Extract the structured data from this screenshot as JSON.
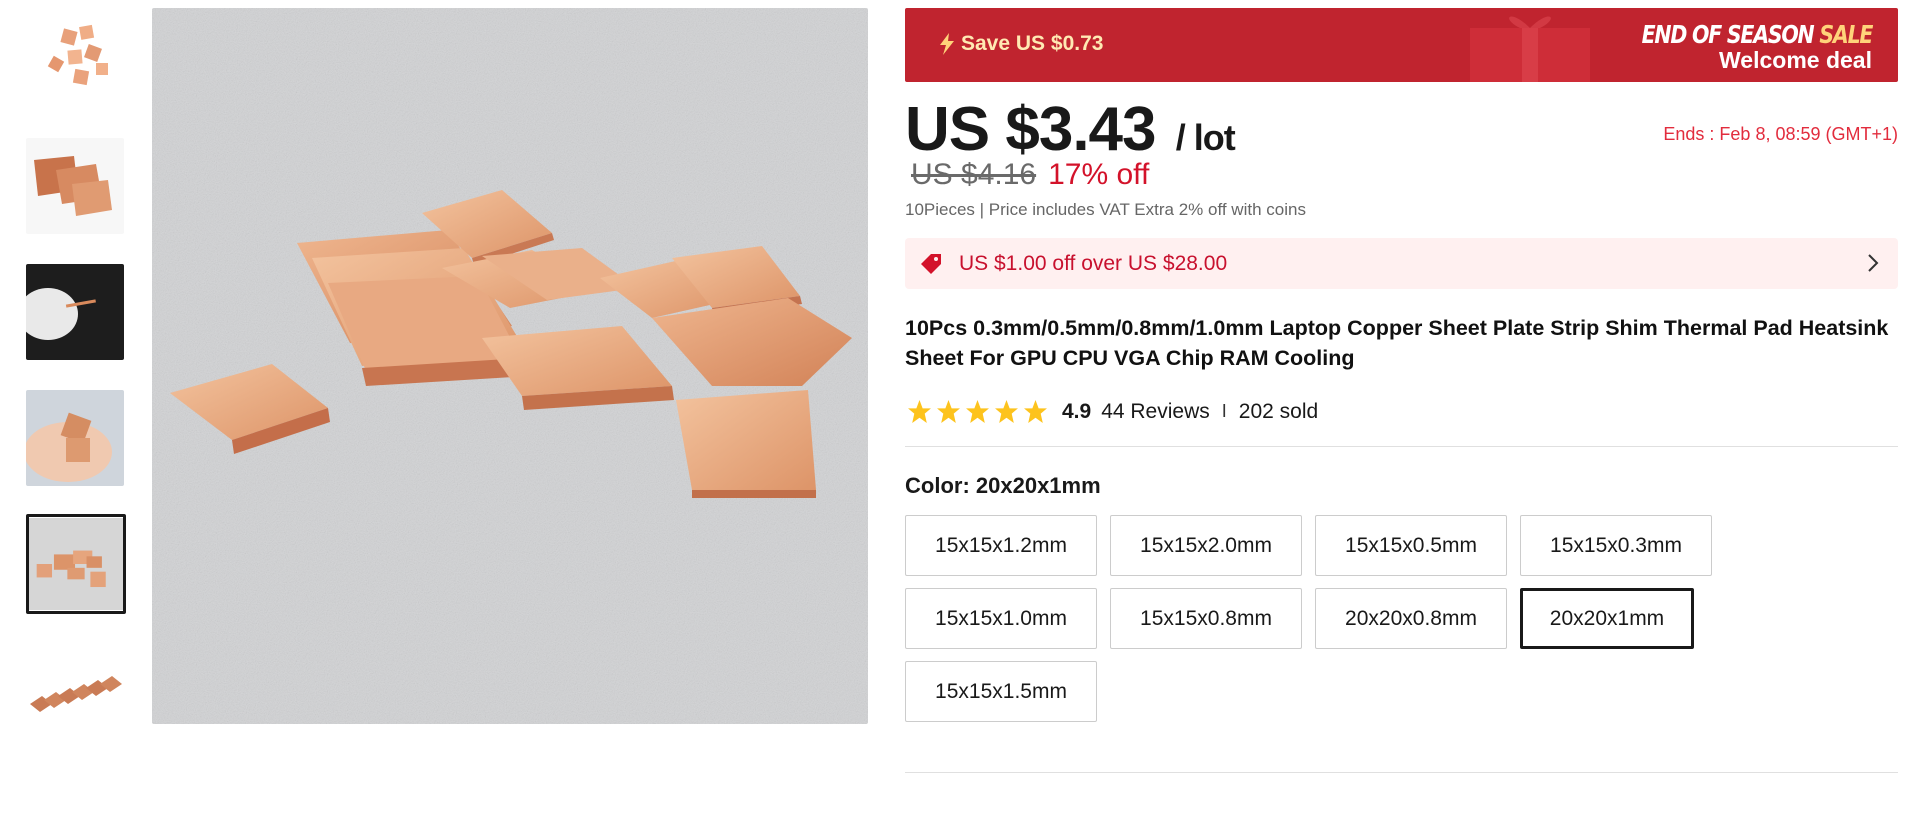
{
  "gallery": {
    "thumbnails": [
      {
        "name": "thumb-1",
        "active": false
      },
      {
        "name": "thumb-2",
        "active": false
      },
      {
        "name": "thumb-3",
        "active": false
      },
      {
        "name": "thumb-4",
        "active": false
      },
      {
        "name": "thumb-5",
        "active": true
      },
      {
        "name": "thumb-6",
        "active": false
      }
    ]
  },
  "banner": {
    "save_text": "Save US $0.73",
    "sale_word1": "END OF SEASON ",
    "sale_word2": "SALE",
    "welcome": "Welcome deal",
    "color": "#c0242f"
  },
  "price": {
    "current": "US $3.43",
    "unit": "/ lot",
    "ends": "Ends :  Feb 8, 08:59 (GMT+1)",
    "original": "US $4.16",
    "discount": "17% off",
    "vat_note": "10Pieces | Price includes VAT Extra 2% off with coins"
  },
  "coupon": {
    "text": "US $1.00 off over US $28.00",
    "icon": "tag-icon"
  },
  "product": {
    "title": "10Pcs 0.3mm/0.5mm/0.8mm/1.0mm Laptop Copper Sheet Plate Strip Shim Thermal Pad Heatsink Sheet For GPU CPU VGA Chip RAM Cooling"
  },
  "rating": {
    "score": "4.9",
    "stars": 5,
    "reviews": "44 Reviews",
    "separator": "I",
    "sold": "202 sold"
  },
  "color": {
    "label_prefix": "Color: ",
    "selected": "20x20x1mm",
    "options": [
      "15x15x1.2mm",
      "15x15x2.0mm",
      "15x15x0.5mm",
      "15x15x0.3mm",
      "15x15x1.0mm",
      "15x15x0.8mm",
      "20x20x0.8mm",
      "20x20x1mm",
      "15x15x1.5mm"
    ]
  }
}
